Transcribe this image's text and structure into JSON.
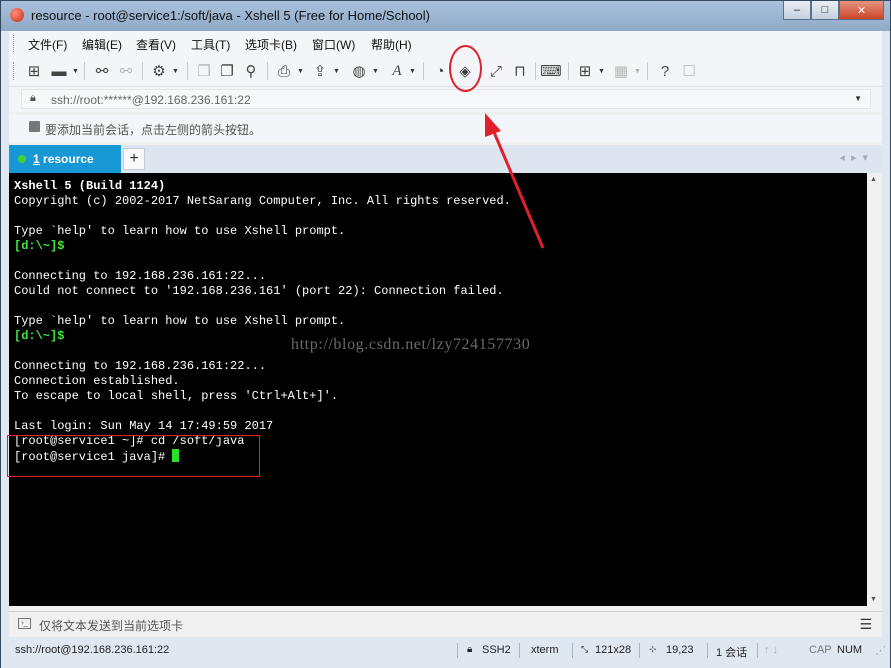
{
  "window": {
    "title": "resource - root@service1:/soft/java - Xshell 5 (Free for Home/School)",
    "buttons": [
      "–",
      "□",
      "✕"
    ]
  },
  "menu": [
    "文件(F)",
    "编辑(E)",
    "查看(V)",
    "工具(T)",
    "选项卡(B)",
    "窗口(W)",
    "帮助(H)"
  ],
  "toolbar": {
    "icons": [
      "new-session-icon",
      "open-folder-icon",
      "reconnect-icon",
      "disconnect-icon",
      "properties-icon",
      "copy-icon",
      "paste-icon",
      "find-icon",
      "print-icon",
      "transfer-icon",
      "globe-icon",
      "font-icon",
      "xftp-icon",
      "xmanager-icon",
      "fullscreen-icon",
      "lock-icon",
      "keyboard-icon",
      "add-icon",
      "layout-icon",
      "help-icon",
      "chat-icon"
    ]
  },
  "address": {
    "value": "ssh://root:******@192.168.236.161:22"
  },
  "hint": {
    "text": "要添加当前会话，点击左侧的箭头按钮。"
  },
  "tabs": {
    "active_number": "1",
    "active_name": " resource",
    "add_label": "+"
  },
  "terminal": {
    "lines": [
      {
        "text": "Xshell 5 (Build 1124)",
        "style": "bold"
      },
      {
        "text": "Copyright (c) 2002-2017 NetSarang Computer, Inc. All rights reserved.",
        "style": "normal"
      },
      {
        "text": "",
        "style": "normal"
      },
      {
        "text": "Type `help' to learn how to use Xshell prompt.",
        "style": "normal"
      },
      {
        "text": "[d:\\~]$",
        "style": "prompt"
      },
      {
        "text": "",
        "style": "normal"
      },
      {
        "text": "Connecting to 192.168.236.161:22...",
        "style": "normal"
      },
      {
        "text": "Could not connect to '192.168.236.161' (port 22): Connection failed.",
        "style": "normal"
      },
      {
        "text": "",
        "style": "normal"
      },
      {
        "text": "Type `help' to learn how to use Xshell prompt.",
        "style": "normal"
      },
      {
        "text": "[d:\\~]$",
        "style": "prompt"
      },
      {
        "text": "",
        "style": "normal"
      },
      {
        "text": "Connecting to 192.168.236.161:22...",
        "style": "normal"
      },
      {
        "text": "Connection established.",
        "style": "normal"
      },
      {
        "text": "To escape to local shell, press 'Ctrl+Alt+]'.",
        "style": "normal"
      },
      {
        "text": "",
        "style": "normal"
      },
      {
        "text": "Last login: Sun May 14 17:49:59 2017",
        "style": "normal"
      },
      {
        "text": "[root@service1 ~]# cd /soft/java",
        "style": "normal"
      },
      {
        "text": "[root@service1 java]# ",
        "style": "cursor"
      }
    ],
    "watermark": "http://blog.csdn.net/lzy724157730"
  },
  "sendbar": {
    "placeholder": "仅将文本发送到当前选项卡",
    "menu_icon": "☰"
  },
  "status": {
    "connection": "ssh://root@192.168.236.161:22",
    "protocol": "SSH2",
    "terminal_type": "xterm",
    "size": "121x28",
    "cursor_pos": "19,23",
    "sessions": "1 会话",
    "cap": "CAP",
    "num": "NUM"
  },
  "colors": {
    "tab_active": "#1798d5",
    "prompt_green": "#3fe83f",
    "annotation_red": "#e0202a"
  }
}
